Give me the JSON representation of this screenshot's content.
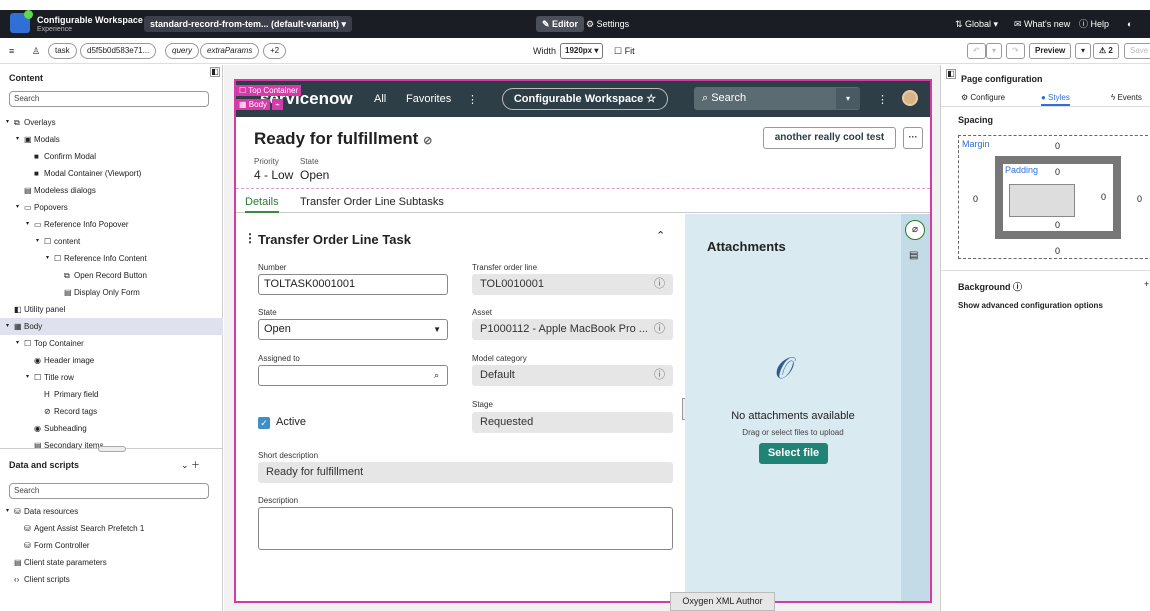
{
  "topbar": {
    "app_title": "Configurable Workspace",
    "app_subtitle": "Experience",
    "variant_label": "standard-record-from-tem... (default-variant) ▾",
    "editor_label": "✎ Editor",
    "settings_label": "⚙ Settings",
    "global_label": "⇅ Global ▾",
    "whats_new_label": "✉ What's new",
    "help_label": "ⓘ Help"
  },
  "toolbar": {
    "tags": [
      "task",
      "d5f5b0d583e71...",
      "query",
      "extraParams",
      "+2"
    ],
    "width_label": "Width",
    "width_value": "1920px ▾",
    "fit_label": "☐ Fit",
    "preview_label": "Preview",
    "warning_count": "⚠ 2",
    "save_label": "Save"
  },
  "left_panel": {
    "content_title": "Content",
    "search_placeholder": "Search",
    "tree": [
      {
        "label": "Overlays",
        "tw": "▾",
        "icon": "⧉",
        "indent": 0
      },
      {
        "label": "Modals",
        "tw": "▾",
        "icon": "▣",
        "indent": 1
      },
      {
        "label": "Confirm Modal",
        "tw": "",
        "icon": "■",
        "indent": 2
      },
      {
        "label": "Modal Container (Viewport)",
        "tw": "",
        "icon": "■",
        "indent": 2
      },
      {
        "label": "Modeless dialogs",
        "tw": "",
        "icon": "▤",
        "indent": 1
      },
      {
        "label": "Popovers",
        "tw": "▾",
        "icon": "▭",
        "indent": 1
      },
      {
        "label": "Reference Info Popover",
        "tw": "▾",
        "icon": "▭",
        "indent": 2
      },
      {
        "label": "content",
        "tw": "▾",
        "icon": "☐",
        "indent": 3
      },
      {
        "label": "Reference Info Content",
        "tw": "▾",
        "icon": "☐",
        "indent": 4
      },
      {
        "label": "Open Record Button",
        "tw": "",
        "icon": "⧉",
        "indent": 5
      },
      {
        "label": "Display Only Form",
        "tw": "",
        "icon": "▤",
        "indent": 5
      },
      {
        "label": "Utility panel",
        "tw": "",
        "icon": "◧",
        "indent": 0
      },
      {
        "label": "Body",
        "tw": "▾",
        "icon": "▦",
        "indent": 0,
        "selected": true
      },
      {
        "label": "Top Container",
        "tw": "▾",
        "icon": "☐",
        "indent": 1
      },
      {
        "label": "Header image",
        "tw": "",
        "icon": "◉",
        "indent": 2
      },
      {
        "label": "Title row",
        "tw": "▾",
        "icon": "☐",
        "indent": 2
      },
      {
        "label": "Primary field",
        "tw": "",
        "icon": "H",
        "indent": 3
      },
      {
        "label": "Record tags",
        "tw": "",
        "icon": "⊘",
        "indent": 3
      },
      {
        "label": "Subheading",
        "tw": "",
        "icon": "◉",
        "indent": 2
      },
      {
        "label": "Secondary items",
        "tw": "",
        "icon": "▤",
        "indent": 2
      }
    ],
    "data_title": "Data and scripts",
    "data_search_placeholder": "Search",
    "data_tree": [
      {
        "label": "Data resources",
        "tw": "▾",
        "icon": "⛁",
        "indent": 0
      },
      {
        "label": "Agent Assist Search Prefetch 1",
        "tw": "",
        "icon": "⛁",
        "indent": 1
      },
      {
        "label": "Form Controller",
        "tw": "",
        "icon": "⛁",
        "indent": 1
      },
      {
        "label": "Client state parameters",
        "tw": "",
        "icon": "▤",
        "indent": 0
      },
      {
        "label": "Client scripts",
        "tw": "",
        "icon": "‹›",
        "indent": 0
      }
    ]
  },
  "canvas": {
    "top_container_tag": "☐ Top Container",
    "body_tag": "▦ Body",
    "nav": {
      "logo": "servicenow",
      "all": "All",
      "favorites": "Favorites",
      "workspace": "Configurable Workspace ☆",
      "search": "Search"
    },
    "record": {
      "title": "Ready for fulfillment",
      "priority_label": "Priority",
      "priority_value": "4 - Low",
      "state_label": "State",
      "state_value": "Open",
      "action_button": "another really cool test",
      "more_button": "···"
    },
    "tabs": [
      "Details",
      "Transfer Order Line Subtasks"
    ],
    "form": {
      "title": "Transfer Order Line Task",
      "number_label": "Number",
      "number_value": "TOLTASK0001001",
      "tol_label": "Transfer order line",
      "tol_value": "TOL0010001",
      "state_label": "State",
      "state_value": "Open",
      "asset_label": "Asset",
      "asset_value": "P1000112 - Apple MacBook Pro ...",
      "assigned_label": "Assigned to",
      "assigned_value": "",
      "model_label": "Model category",
      "model_value": "Default",
      "stage_label": "Stage",
      "stage_value": "Requested",
      "active_label": "Active",
      "short_desc_label": "Short description",
      "short_desc_value": "Ready for fulfillment",
      "desc_label": "Description",
      "desc_value": ""
    },
    "attachments": {
      "title": "Attachments",
      "empty": "No attachments available",
      "hint": "Drag or select files to upload",
      "button": "Select file"
    }
  },
  "right_panel": {
    "title": "Page configuration",
    "tabs": [
      "⚙ Configure",
      "● Styles",
      "ϟ Events"
    ],
    "spacing_title": "Spacing",
    "margin_label": "Margin",
    "padding_label": "Padding",
    "margin": {
      "top": "0",
      "left": "0",
      "right": "0",
      "bottom": "0"
    },
    "padding": {
      "top": "0",
      "left": "0",
      "right": "0",
      "bottom": "0"
    },
    "background_title": "Background ⓘ",
    "add": "+",
    "advanced": "Show advanced configuration options"
  },
  "dock_label": "Oxygen XML Author",
  "colors": {
    "accent": "#d63aa8",
    "nav": "#2d3e46",
    "green": "#1f8476"
  }
}
